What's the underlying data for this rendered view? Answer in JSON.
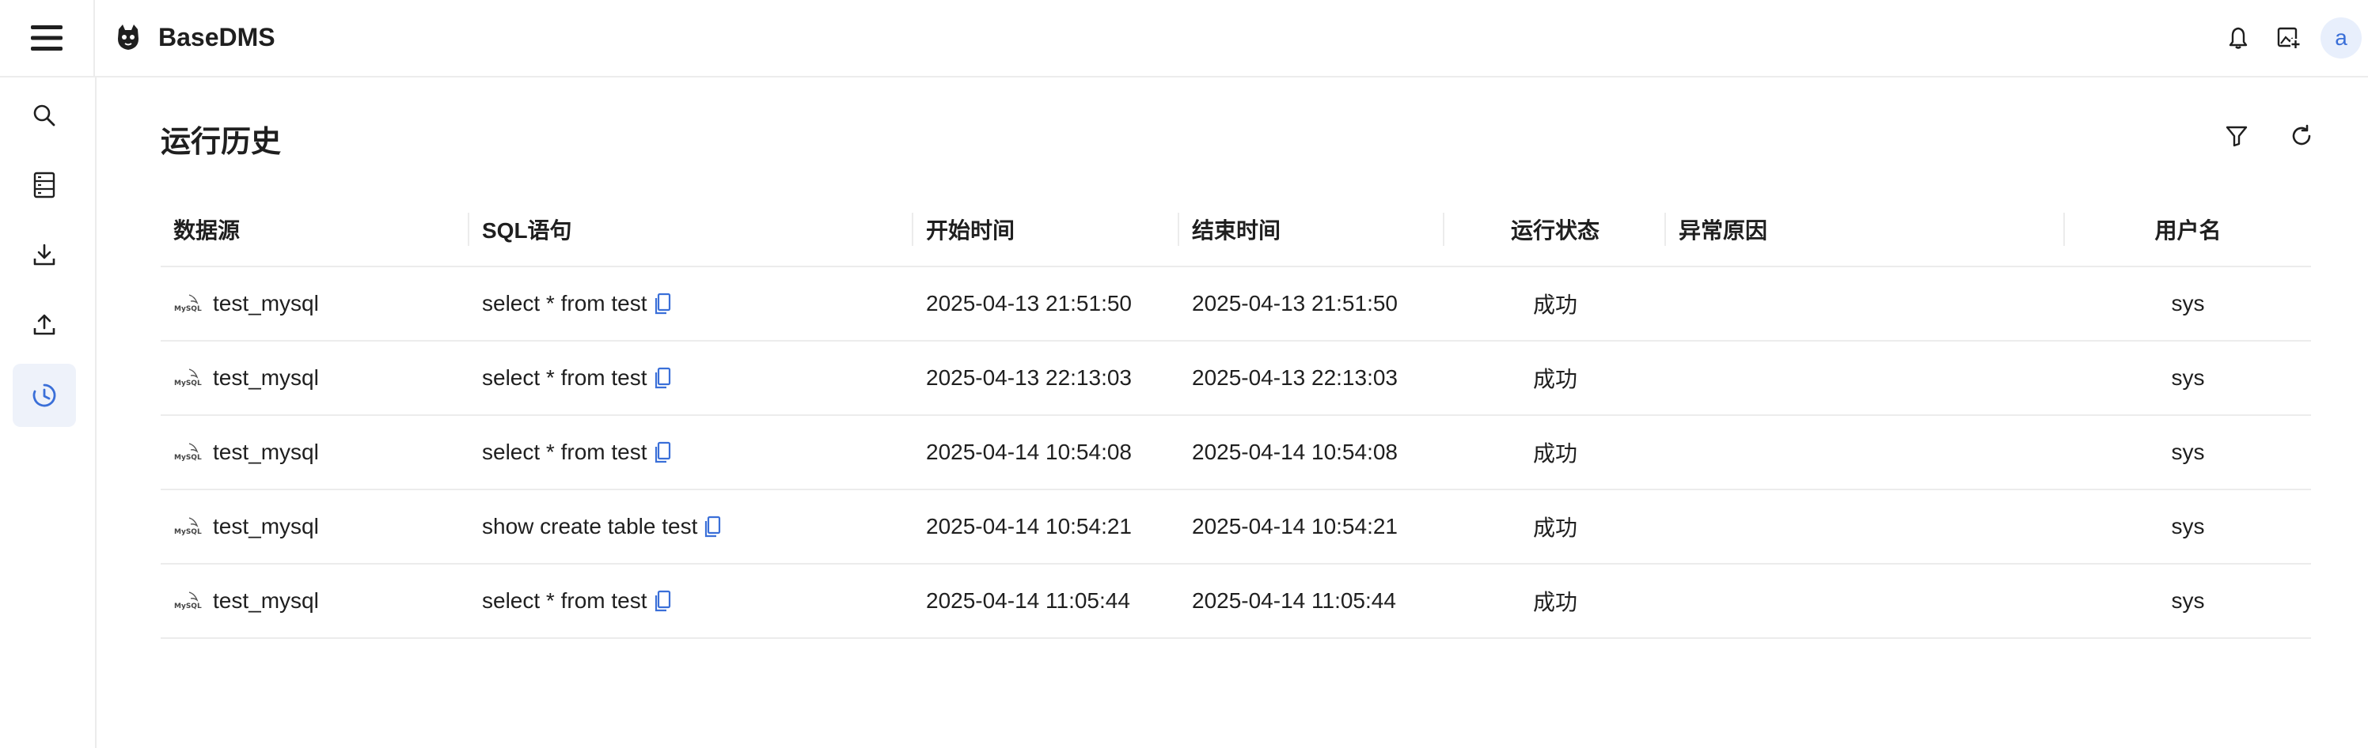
{
  "app": {
    "title": "BaseDMS",
    "avatar_letter": "a"
  },
  "page": {
    "title": "运行历史"
  },
  "sidebar": {
    "items": [
      {
        "name": "search",
        "icon": "search-icon"
      },
      {
        "name": "database",
        "icon": "database-icon"
      },
      {
        "name": "download",
        "icon": "download-icon"
      },
      {
        "name": "upload",
        "icon": "upload-icon"
      },
      {
        "name": "history",
        "icon": "history-icon",
        "active": true
      }
    ]
  },
  "table": {
    "columns": [
      "数据源",
      "SQL语句",
      "开始时间",
      "结束时间",
      "运行状态",
      "异常原因",
      "用户名"
    ],
    "rows": [
      {
        "datasource": "test_mysql",
        "sql": "select * from test",
        "start": "2025-04-13 21:51:50",
        "end": "2025-04-13 21:51:50",
        "status": "成功",
        "error": "",
        "user": "sys"
      },
      {
        "datasource": "test_mysql",
        "sql": "select * from test",
        "start": "2025-04-13 22:13:03",
        "end": "2025-04-13 22:13:03",
        "status": "成功",
        "error": "",
        "user": "sys"
      },
      {
        "datasource": "test_mysql",
        "sql": "select * from test",
        "start": "2025-04-14 10:54:08",
        "end": "2025-04-14 10:54:08",
        "status": "成功",
        "error": "",
        "user": "sys"
      },
      {
        "datasource": "test_mysql",
        "sql": "show create table test",
        "start": "2025-04-14 10:54:21",
        "end": "2025-04-14 10:54:21",
        "status": "成功",
        "error": "",
        "user": "sys"
      },
      {
        "datasource": "test_mysql",
        "sql": "select * from test",
        "start": "2025-04-14 11:05:44",
        "end": "2025-04-14 11:05:44",
        "status": "成功",
        "error": "",
        "user": "sys"
      }
    ]
  },
  "colors": {
    "accent": "#3a6fd8",
    "border": "#ececec",
    "active_bg": "#eef2fa"
  }
}
